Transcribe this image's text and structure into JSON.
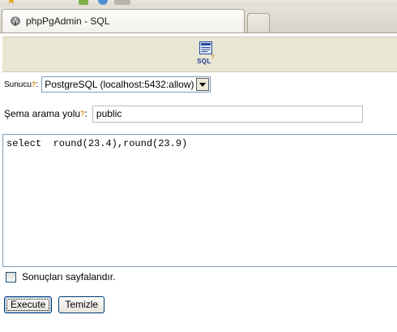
{
  "browser": {
    "tab_title": "phpPgAdmin - SQL"
  },
  "header": {
    "icon": "sql-icon",
    "label": "SQL",
    "help": "?"
  },
  "form": {
    "server_label": "Sunucu",
    "server_help": "?",
    "server_value": "PostgreSQL (localhost:5432:allow)",
    "schema_label": "Şema arama yolu",
    "schema_help": "?",
    "schema_value": "public",
    "query": "select  round(23.4),round(23.9)",
    "paginate_label": "Sonuçları sayfalandır.",
    "paginate_checked": false
  },
  "buttons": {
    "execute": "Execute",
    "reset": "Temizle"
  },
  "colors": {
    "header_bg": "#e9e6d3",
    "help_mark": "#d48b1a",
    "input_border": "#7f9db9"
  }
}
